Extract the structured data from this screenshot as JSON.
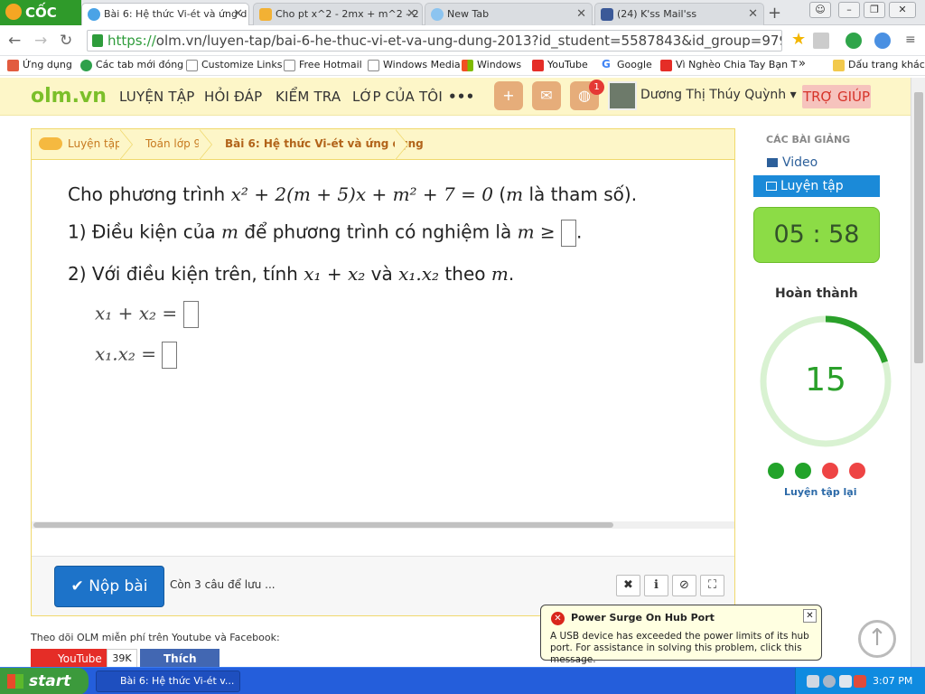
{
  "browser": {
    "brand": "CỐC CỐC",
    "tabs": [
      {
        "label": "Bài 6: Hệ thức Vi-ét và ứng d",
        "active": true
      },
      {
        "label": "Cho pt x^2 - 2mx + m^2 - 2",
        "active": false
      },
      {
        "label": "New Tab",
        "active": false
      },
      {
        "label": "(24) K'ss Mail'ss",
        "active": false
      }
    ],
    "url_protocol": "https://",
    "url_rest": "olm.vn/luyen-tap/bai-6-he-thuc-vi-et-va-ung-dung-2013?id_student=5587843&id_group=97927"
  },
  "bookmarks": [
    "Ứng dụng",
    "Các tab mới đóng",
    "Customize Links",
    "Free Hotmail",
    "Windows Media",
    "Windows",
    "YouTube",
    "Google",
    "Vì Nghèo Chia Tay Bạn T"
  ],
  "bookmarks_more": "»",
  "bookmarks_other": "Dấu trang khác",
  "olm": {
    "logo": "olm.vn",
    "menu": [
      "LUYỆN TẬP",
      "HỎI ĐÁP",
      "KIỂM TRA",
      "LỚP CỦA TÔI",
      "•••"
    ],
    "notification_count": "1",
    "username": "Dương Thị Thúy Quỳnh ▾",
    "help": "TRỢ GIÚP"
  },
  "breadcrumb": [
    "Luyện tập",
    "Toán lớp 9",
    "Bài 6: Hệ thức Vi-ét và ứng dụng"
  ],
  "question": {
    "line1_text": "Cho phương trình ",
    "line1_math": "x² + 2(m + 5)x + m² + 7 = 0",
    "line1_open": " (",
    "line1_m": "m",
    "line1_end": " là tham số).",
    "line2_text": "1) Điều kiện của ",
    "line2_m": "m",
    "line2_mid": " để phương trình có nghiệm là ",
    "line2_math": "m ≥",
    "line2_end": ".",
    "line3_text": "2) Với điều kiện trên, tính ",
    "line3_a": "x₁ + x₂",
    "line3_and": " và ",
    "line3_b": "x₁.x₂",
    "line3_theo": " theo ",
    "line3_m": "m",
    "line3_end": ".",
    "sum_label": "x₁ + x₂ =",
    "prod_label": "x₁.x₂ ="
  },
  "footer": {
    "submit": "✔ Nộp bài",
    "remaining": "Còn 3 câu để lưu ...",
    "tools": [
      "✖",
      "ℹ",
      "⊘",
      "⛶"
    ]
  },
  "sidebar": {
    "lectures_title": "CÁC BÀI GIẢNG",
    "video": "Video",
    "practice": "Luyện tập",
    "timer": "05 : 58",
    "done_label": "Hoàn thành",
    "score": "15",
    "progress_fraction": 0.2,
    "results": [
      "correct",
      "correct",
      "wrong",
      "wrong"
    ],
    "retry": "Luyện tập lại"
  },
  "follow": {
    "text": "Theo dõi OLM miễn phí trên Youtube và Facebook:",
    "youtube": "YouTube",
    "youtube_count": "39K",
    "facebook": "Thích 19K"
  },
  "balloon": {
    "title": "Power Surge On Hub Port",
    "message": "A USB device has exceeded the power limits of its hub port. For assistance in solving this problem, click this message."
  },
  "taskbar": {
    "start": "start",
    "task": "Bài 6: Hệ thức Vi-ét v...",
    "clock": "3:07 PM"
  },
  "colors": {
    "correct": "#22a32a",
    "wrong": "#ee4444",
    "ring_bg": "#d9f2d2",
    "ring_fg": "#2aa02a"
  }
}
